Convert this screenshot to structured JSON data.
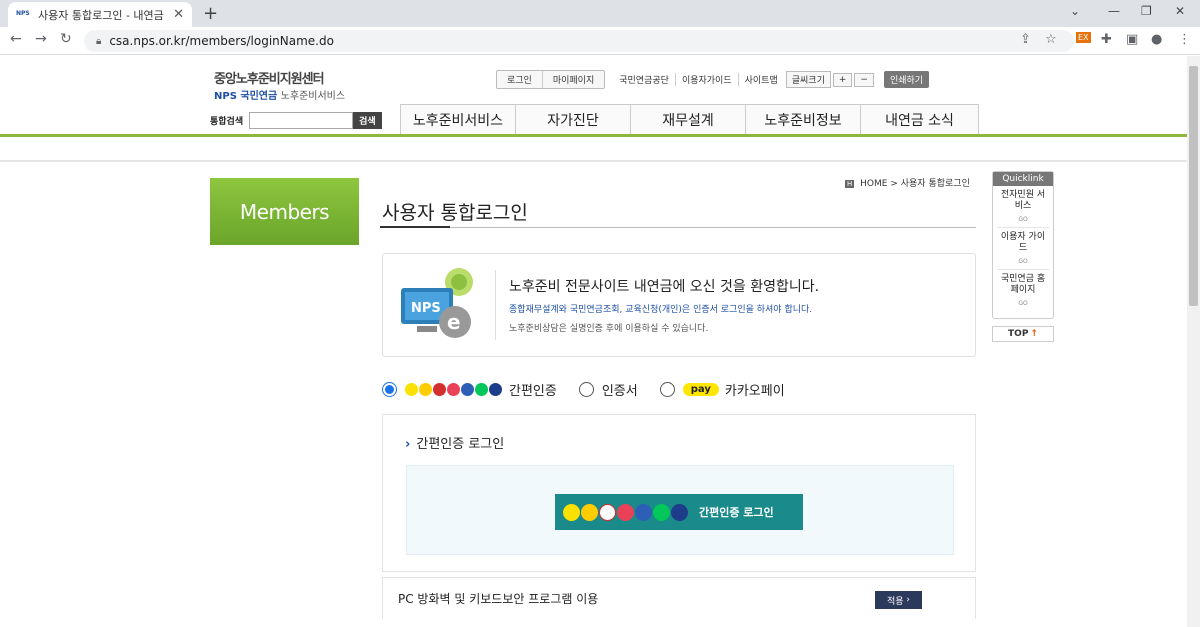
{
  "browser": {
    "tab_title": "사용자 통합로그인 - 내연금",
    "url": "csa.nps.or.kr/members/loginName.do",
    "favicon_text": "NPS"
  },
  "site": {
    "logo_line1": "중앙노후준비지원센터",
    "logo_nps": "NPS 국민연금",
    "logo_line2": "노후준비서비스"
  },
  "util": {
    "login": "로그인",
    "mypage": "마이페이지",
    "nps": "국민연금공단",
    "guide": "이용자가이드",
    "sitemap": "사이트맵",
    "fontsize": "글씨크기",
    "plus": "+",
    "minus": "−",
    "print": "인쇄하기"
  },
  "search": {
    "label": "통합검색",
    "button": "검색"
  },
  "gnb": [
    "노후준비서비스",
    "자가진단",
    "재무설계",
    "노후준비정보",
    "내연금 소식"
  ],
  "sidebar": {
    "members": "Members"
  },
  "breadcrumb": {
    "home": "HOME",
    "sep": ">",
    "current": "사용자 통합로그인"
  },
  "page_title": "사용자 통합로그인",
  "welcome": {
    "line1": "노후준비 전문사이트 내연금에 오신 것을 환영합니다.",
    "line2": "종합재무설계와 국민연금조회, 교육신청(개인)은 인증서 로그인을 하셔야 합니다.",
    "line3": "노후준비상담은 실명인증 후에 이용하실 수 있습니다."
  },
  "auth_options": {
    "simple": "간편인증",
    "cert": "인증서",
    "kakao": "카카오페이",
    "kakao_badge": "pay"
  },
  "simple_box": {
    "title": "간편인증 로그인",
    "button": "간편인증 로그인"
  },
  "pc_row": {
    "label": "PC 방화벽 및 키보드보안 프로그램 이용",
    "apply": "적용"
  },
  "quicklink": {
    "header": "Quicklink",
    "items": [
      {
        "label": "전자민원 서비스",
        "go": "GO"
      },
      {
        "label": "이용자 가이드",
        "go": "GO"
      },
      {
        "label": "국민연금 홈페이지",
        "go": "GO"
      }
    ],
    "top": "TOP"
  },
  "colors": {
    "green": "#8db73d",
    "blue": "#1e4fa3",
    "teal": "#1a8a8a"
  }
}
